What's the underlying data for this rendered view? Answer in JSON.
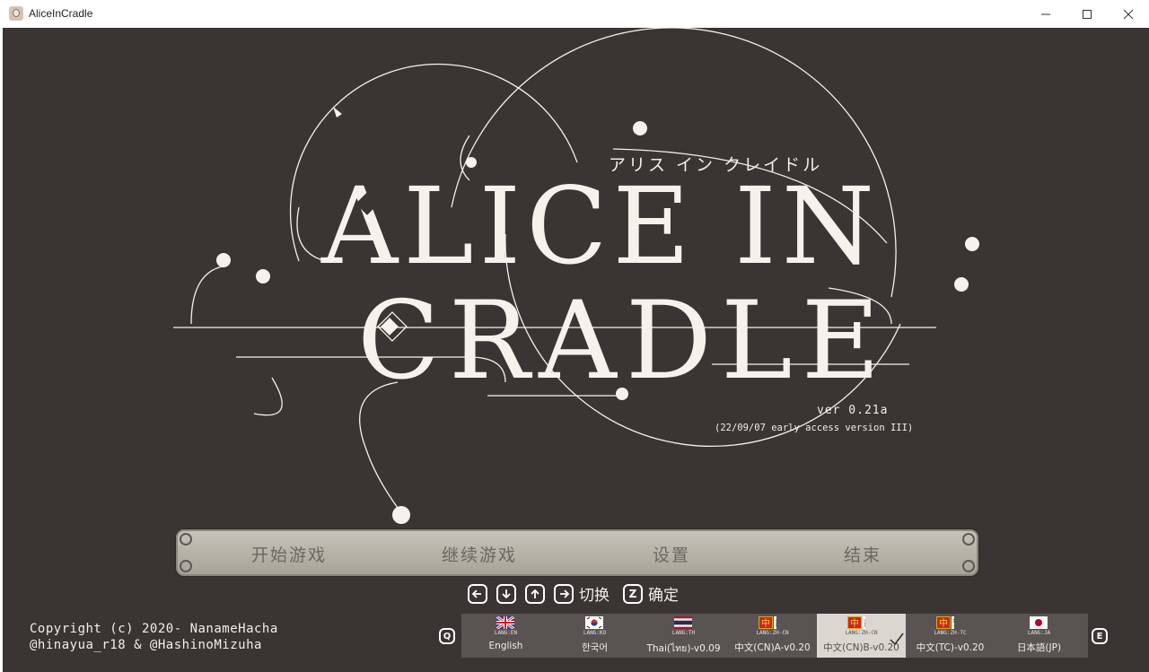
{
  "window": {
    "title": "AliceInCradle",
    "icons": [
      "app-icon",
      "minimize-icon",
      "maximize-icon",
      "close-icon"
    ]
  },
  "logo": {
    "subtitle_jp": "アリス イン クレイドル",
    "line1": "ALICE IN",
    "line2": "CRADLE",
    "version": "ver 0.21a",
    "build": "(22/09/07 early access version III)"
  },
  "main_menu": {
    "start": "开始游戏",
    "continue": "继续游戏",
    "settings": "设置",
    "quit": "结束"
  },
  "controls": {
    "switch_label": "切换",
    "confirm_key": "Z",
    "confirm_label": "确定",
    "icons": [
      "arrow-left-icon",
      "arrow-down-icon",
      "arrow-up-icon",
      "arrow-right-icon"
    ]
  },
  "copyright": {
    "line1": "Copyright (c) 2020- NanameHacha",
    "line2": "@hinayua_r18 & @HashinoMizuha"
  },
  "language_bar": {
    "prev_key": "Q",
    "next_key": "E",
    "selected_index": 4,
    "languages": [
      {
        "name": "English",
        "code": "LANG:EN",
        "flag": "uk-flag-icon"
      },
      {
        "name": "한국어",
        "code": "LANG:KO",
        "flag": "korea-flag-icon"
      },
      {
        "name": "Thai(ไทย)-v0.09",
        "code": "LANG:TH",
        "flag": "thailand-flag-icon"
      },
      {
        "name": "中文(CN)A-v0.20",
        "code": "LANG:ZH-CN",
        "flag": "chinese-simplified-icon",
        "badge": "简"
      },
      {
        "name": "中文(CN)B-v0.20",
        "code": "LANG:ZH-CN",
        "flag": "chinese-simplified-icon",
        "badge": "简"
      },
      {
        "name": "中文(TC)-v0.20",
        "code": "LANG:ZH-TC",
        "flag": "chinese-traditional-icon",
        "badge": "繁"
      },
      {
        "name": "日本語(JP)",
        "code": "LANG:JA",
        "flag": "japan-flag-icon"
      }
    ]
  },
  "colors": {
    "background": "#3a3432",
    "logo": "#f5f2ec",
    "menu_bar": "#b8b3a9",
    "menu_text": "#6c675f",
    "lang_bar": "#595352",
    "lang_selected": "#dad6d0"
  }
}
